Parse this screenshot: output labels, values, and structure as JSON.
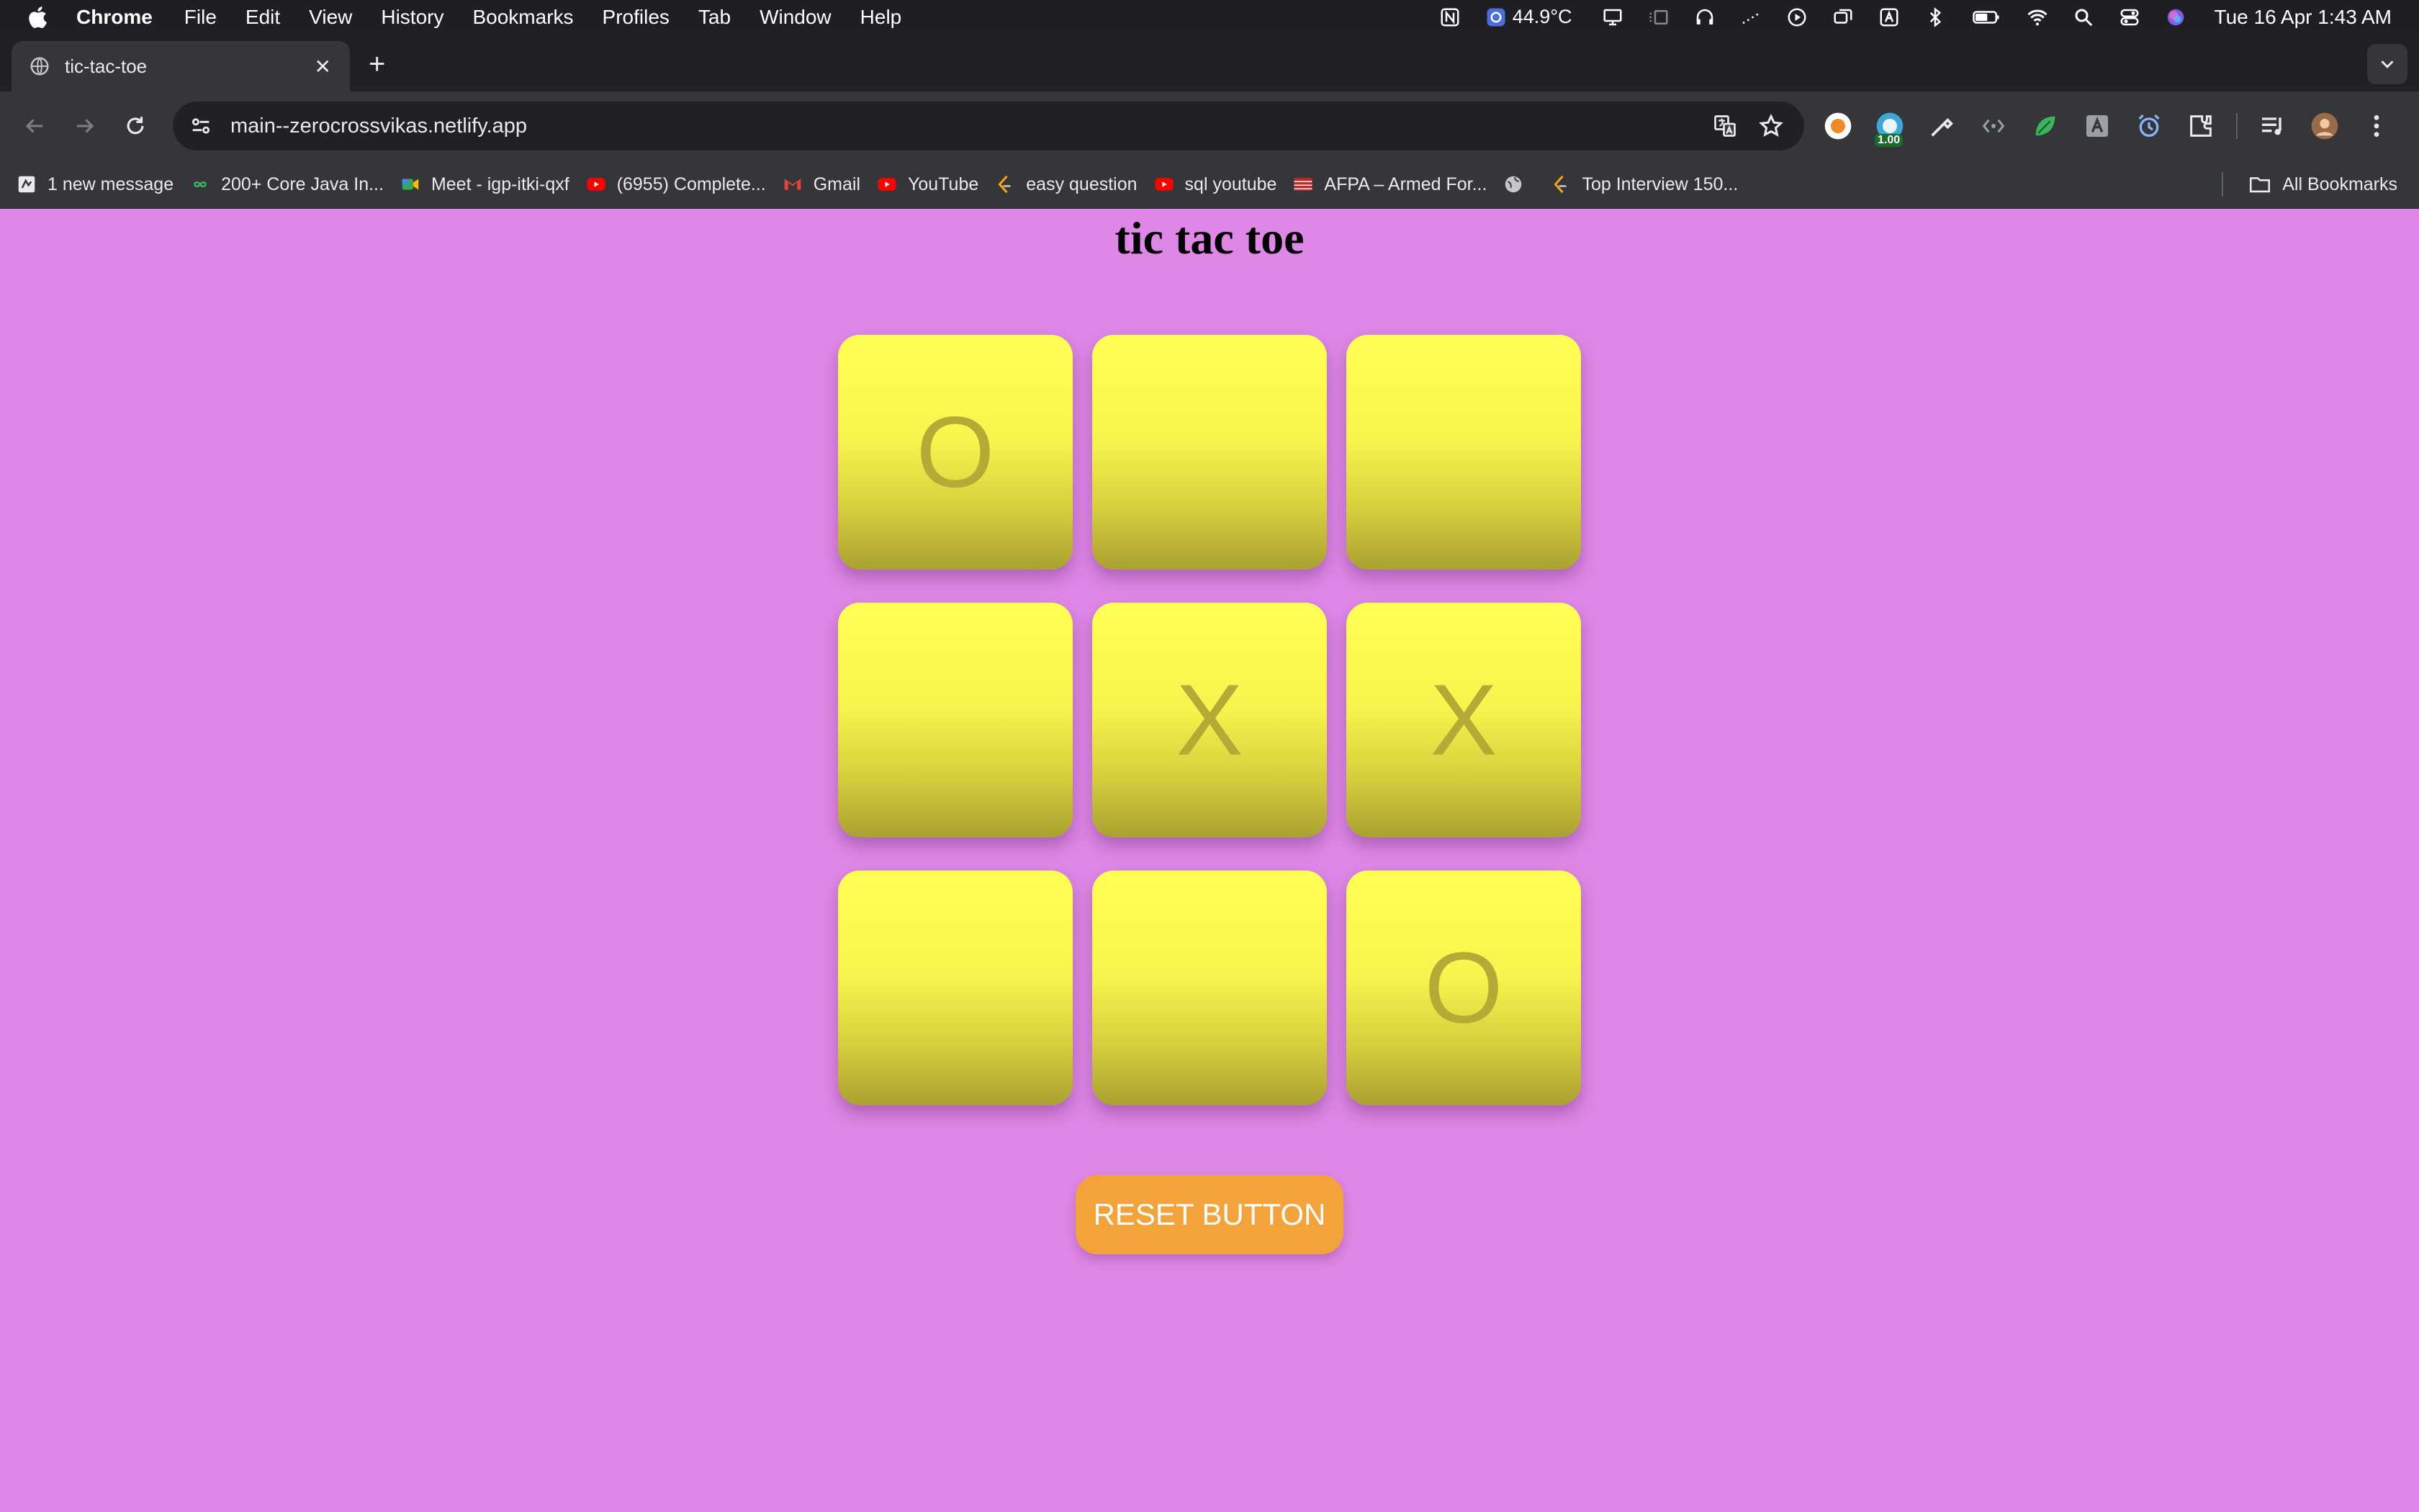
{
  "menubar": {
    "app": "Chrome",
    "items": [
      "File",
      "Edit",
      "View",
      "History",
      "Bookmarks",
      "Profiles",
      "Tab",
      "Window",
      "Help"
    ],
    "temperature": "44.9°C",
    "clock": "Tue 16 Apr  1:43 AM"
  },
  "tab": {
    "title": "tic-tac-toe"
  },
  "toolbar": {
    "url": "main--zerocrossvikas.netlify.app",
    "extension_badge": "1.00"
  },
  "bookmarks": {
    "items": [
      {
        "label": "1 new message",
        "icon": "notification-icon"
      },
      {
        "label": "200+ Core Java In...",
        "icon": "infinity-icon"
      },
      {
        "label": "Meet - igp-itki-qxf",
        "icon": "meet-icon"
      },
      {
        "label": "(6955) Complete...",
        "icon": "youtube-icon"
      },
      {
        "label": "Gmail",
        "icon": "gmail-icon"
      },
      {
        "label": "YouTube",
        "icon": "youtube-icon"
      },
      {
        "label": "easy question",
        "icon": "leetcode-icon"
      },
      {
        "label": "sql youtube",
        "icon": "youtube-icon"
      },
      {
        "label": "AFPA – Armed For...",
        "icon": "afpa-icon"
      },
      {
        "label": "",
        "icon": "globe-icon"
      },
      {
        "label": "Top Interview 150...",
        "icon": "leetcode-icon"
      }
    ],
    "all_bookmarks": "All Bookmarks"
  },
  "game": {
    "title": "tic tac toe",
    "cells": [
      "O",
      "",
      "",
      "",
      "X",
      "X",
      "",
      "",
      "O"
    ],
    "reset_label": "RESET BUTTON"
  },
  "colors": {
    "page_background": "#de87e6",
    "cell": "#ffff55",
    "mark": "#b3ab35",
    "reset_button": "#f2a33a"
  }
}
